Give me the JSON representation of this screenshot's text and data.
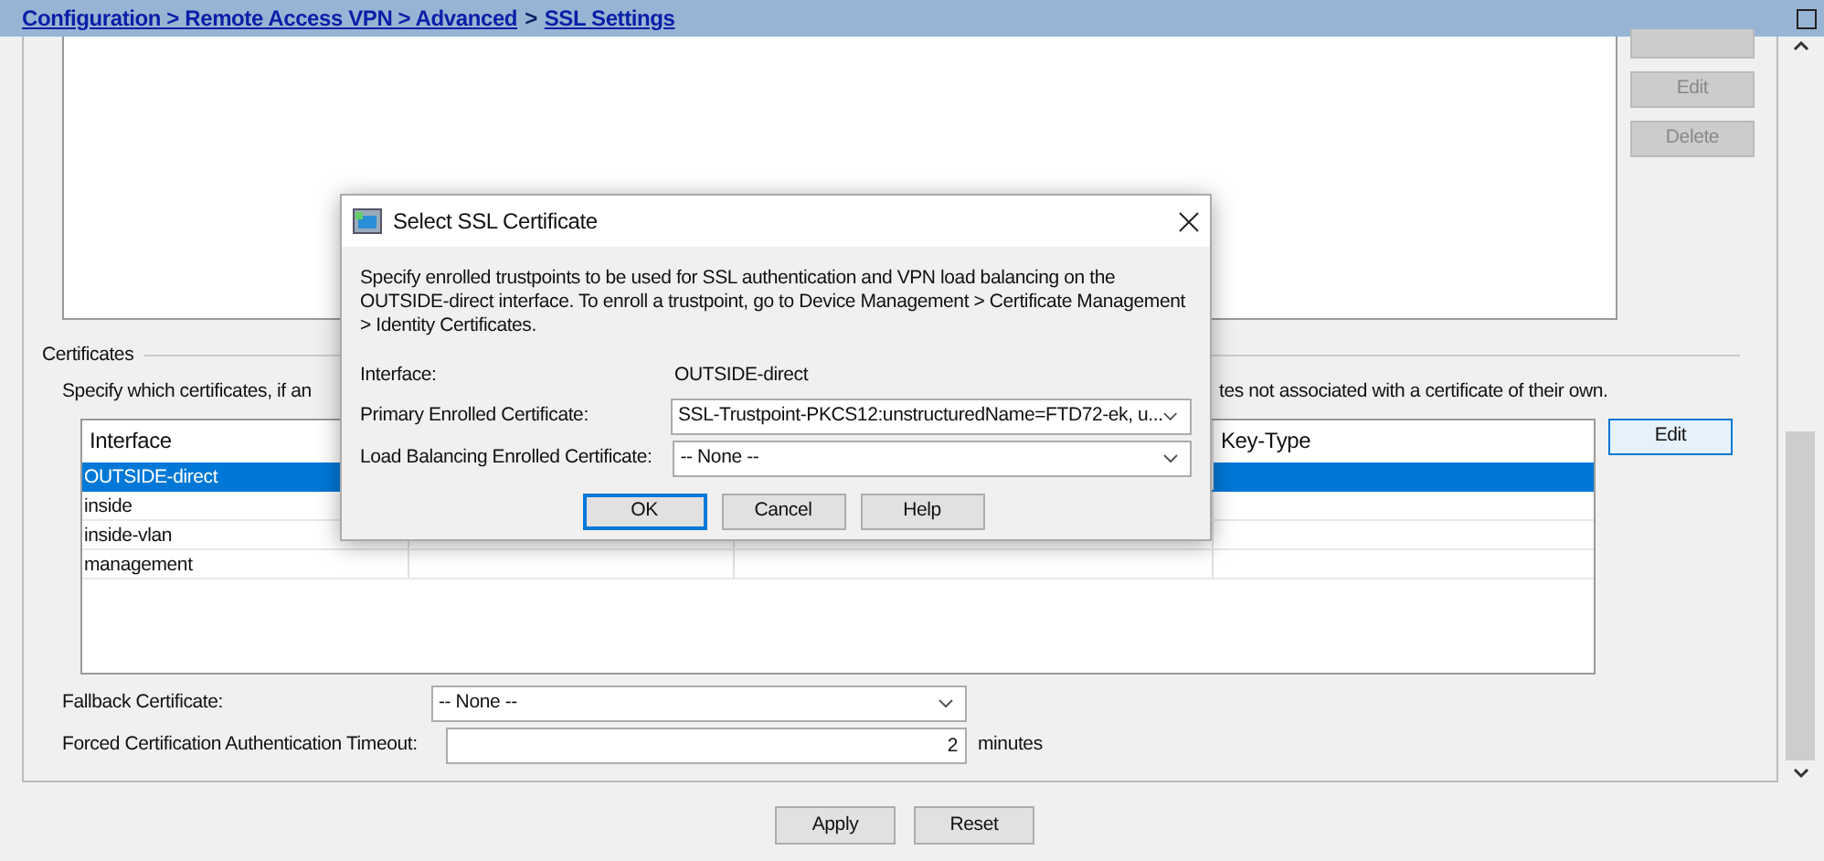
{
  "breadcrumb": [
    {
      "text": "Configuration > Remote Access VPN > Advanced",
      "kind": "link"
    },
    {
      "text": ">",
      "kind": "plain"
    },
    {
      "text": "SSL Settings",
      "kind": "link"
    }
  ],
  "domain_buttons": [
    {
      "label": "Edit",
      "disabled": true
    },
    {
      "label": "Delete",
      "disabled": true
    }
  ],
  "certificates": {
    "title": "Certificates",
    "hint_left": "Specify which certificates, if an",
    "hint_right": "tes not associated with a certificate of their own.",
    "columns": [
      "Interface",
      "Key-Type"
    ],
    "rows": [
      {
        "interface": "OUTSIDE-direct",
        "selected": true
      },
      {
        "interface": "inside",
        "selected": false
      },
      {
        "interface": "inside-vlan",
        "selected": false
      },
      {
        "interface": "management",
        "selected": false
      }
    ],
    "edit_button": "Edit"
  },
  "fallback": {
    "label": "Fallback Certificate:",
    "value": "-- None --"
  },
  "timeout": {
    "label": "Forced Certification Authentication Timeout:",
    "value": "2",
    "unit": "minutes"
  },
  "buttons": [
    "Apply",
    "Reset"
  ],
  "dialog": {
    "title": "Select SSL Certificate",
    "description": "Specify enrolled trustpoints to be used for SSL authentication and VPN load balancing on the OUTSIDE-direct interface. To enroll a trustpoint, go to Device Management > Certificate Management > Identity Certificates.",
    "interface_label": "Interface:",
    "interface_value": "OUTSIDE-direct",
    "primary": {
      "label": "Primary Enrolled Certificate:",
      "value": "SSL-Trustpoint-PKCS12:unstructuredName=FTD72-ek, u..."
    },
    "load_balancing": {
      "label": "Load Balancing Enrolled Certificate:",
      "value": "-- None --"
    },
    "buttons": [
      {
        "label": "OK",
        "default": true
      },
      {
        "label": "Cancel",
        "default": false
      },
      {
        "label": "Help",
        "default": false
      }
    ]
  }
}
